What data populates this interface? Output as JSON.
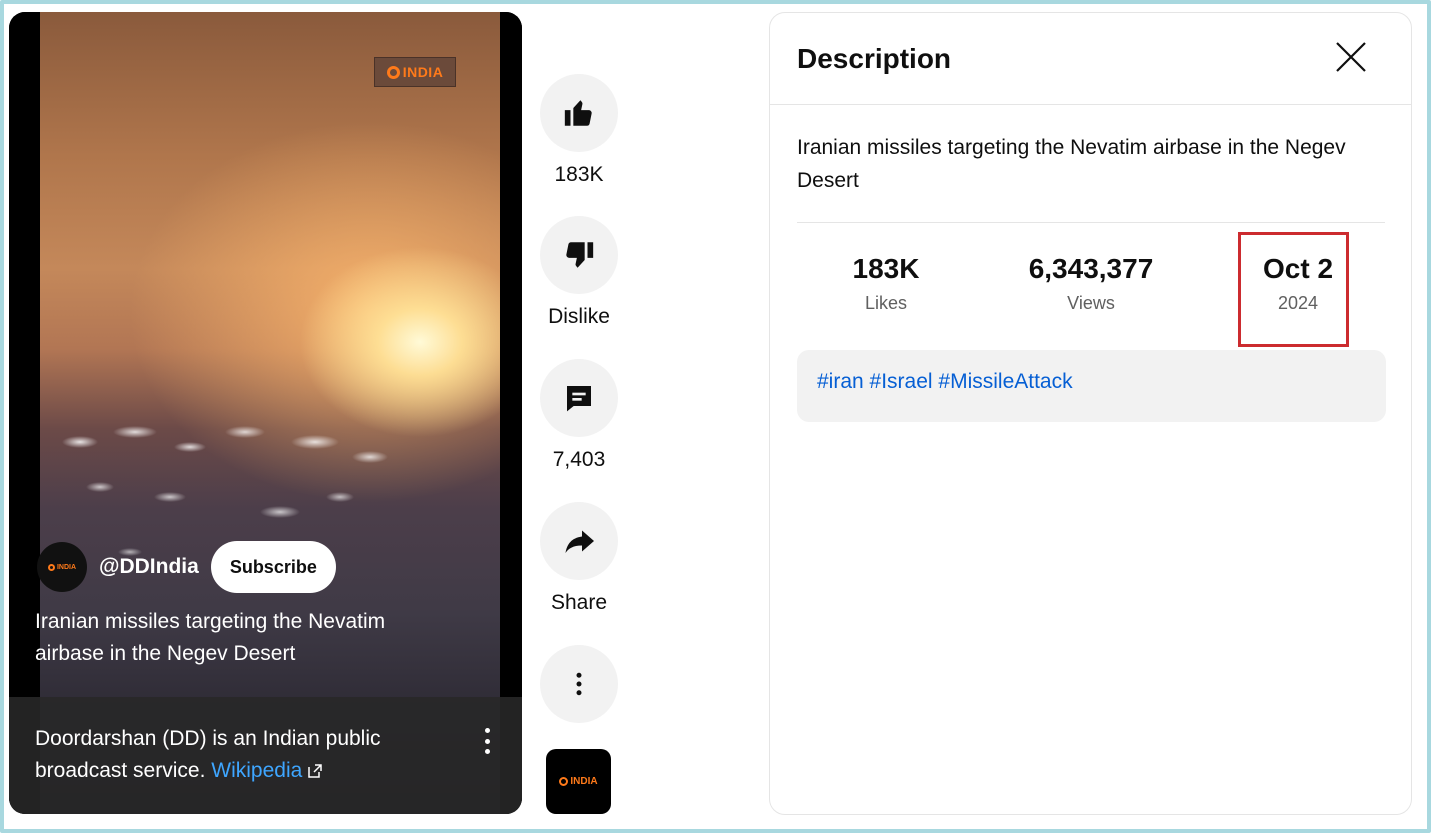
{
  "player": {
    "watermark": "INDIA",
    "channel_handle": "@DDIndia",
    "channel_avatar_text": "INDIA",
    "subscribe_label": "Subscribe",
    "caption": "Iranian missiles targeting the Nevatim airbase in the Negev Desert",
    "info_text": "Doordarshan (DD) is an Indian public broadcast service.",
    "info_link": "Wikipedia"
  },
  "actions": {
    "like_count": "183K",
    "dislike_label": "Dislike",
    "comment_count": "7,403",
    "share_label": "Share",
    "mini_logo_text": "INDIA"
  },
  "description": {
    "title": "Description",
    "text": "Iranian missiles targeting the Nevatim airbase in the Negev Desert",
    "stats": {
      "likes_value": "183K",
      "likes_label": "Likes",
      "views_value": "6,343,377",
      "views_label": "Views",
      "date_value": "Oct 2",
      "date_year": "2024"
    },
    "tags": "#iran #Israel #MissileAttack"
  },
  "colors": {
    "accent_link": "#065fd4",
    "highlight": "#cc2b2f",
    "brand_orange": "#ff7a1a",
    "frame": "#a8d8df"
  },
  "icons": [
    "thumbs-up-icon",
    "thumbs-down-icon",
    "comment-icon",
    "share-icon",
    "more-vert-icon",
    "close-icon",
    "external-link-icon"
  ]
}
